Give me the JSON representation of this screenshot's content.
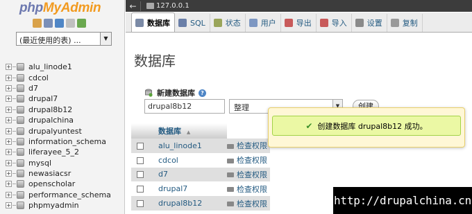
{
  "logo": {
    "php": "php",
    "myadmin": "MyAdmin"
  },
  "nav": {
    "icons": [
      {
        "name": "home-icon",
        "color": "#d9a24a"
      },
      {
        "name": "exit-icon",
        "color": "#7a8fb8"
      },
      {
        "name": "help-icon",
        "color": "#4f86c6"
      },
      {
        "name": "docs-icon",
        "color": "#c0c0c0"
      },
      {
        "name": "reload-icon",
        "color": "#6aa84f"
      }
    ],
    "recent_select": "(最近使用的表) ...",
    "databases": [
      "alu_linode1",
      "cdcol",
      "d7",
      "drupal7",
      "drupal8b12",
      "drupalchina",
      "drupalyuntest",
      "information_schema",
      "liferayee_5_2",
      "mysql",
      "newasiacsr",
      "openscholar",
      "performance_schema",
      "phpmyadmin"
    ]
  },
  "topbar": {
    "back": "←",
    "host": "127.0.0.1"
  },
  "tabs": [
    {
      "label": "数据库",
      "icon": "database-icon",
      "color": "#7b8aa6",
      "active": true
    },
    {
      "label": "SQL",
      "icon": "sql-icon",
      "color": "#6a7fa8",
      "active": false
    },
    {
      "label": "状态",
      "icon": "status-icon",
      "color": "#9aa55a",
      "active": false
    },
    {
      "label": "用户",
      "icon": "users-icon",
      "color": "#7d97c2",
      "active": false
    },
    {
      "label": "导出",
      "icon": "export-icon",
      "color": "#c85a5a",
      "active": false
    },
    {
      "label": "导入",
      "icon": "import-icon",
      "color": "#c85a5a",
      "active": false
    },
    {
      "label": "设置",
      "icon": "settings-icon",
      "color": "#8a8a8a",
      "active": false
    },
    {
      "label": "复制",
      "icon": "replication-icon",
      "color": "#9a9a9a",
      "active": false
    }
  ],
  "main": {
    "title": "数据库",
    "create": {
      "label": "新建数据库",
      "name_value": "drupal8b12",
      "collation": "整理",
      "button": "创建"
    },
    "table": {
      "header": "数据库",
      "sort_arrow": "▲",
      "rows": [
        {
          "name": "alu_linode1",
          "action": "检查权限"
        },
        {
          "name": "cdcol",
          "action": "检查权限"
        },
        {
          "name": "d7",
          "action": "检查权限"
        },
        {
          "name": "drupal7",
          "action": "检查权限"
        },
        {
          "name": "drupal8b12",
          "action": "检查权限"
        }
      ]
    }
  },
  "notice": {
    "check": "✔",
    "message": "创建数据库 drupal8b12 成功。"
  },
  "watermark": "http://drupalchina.cn"
}
